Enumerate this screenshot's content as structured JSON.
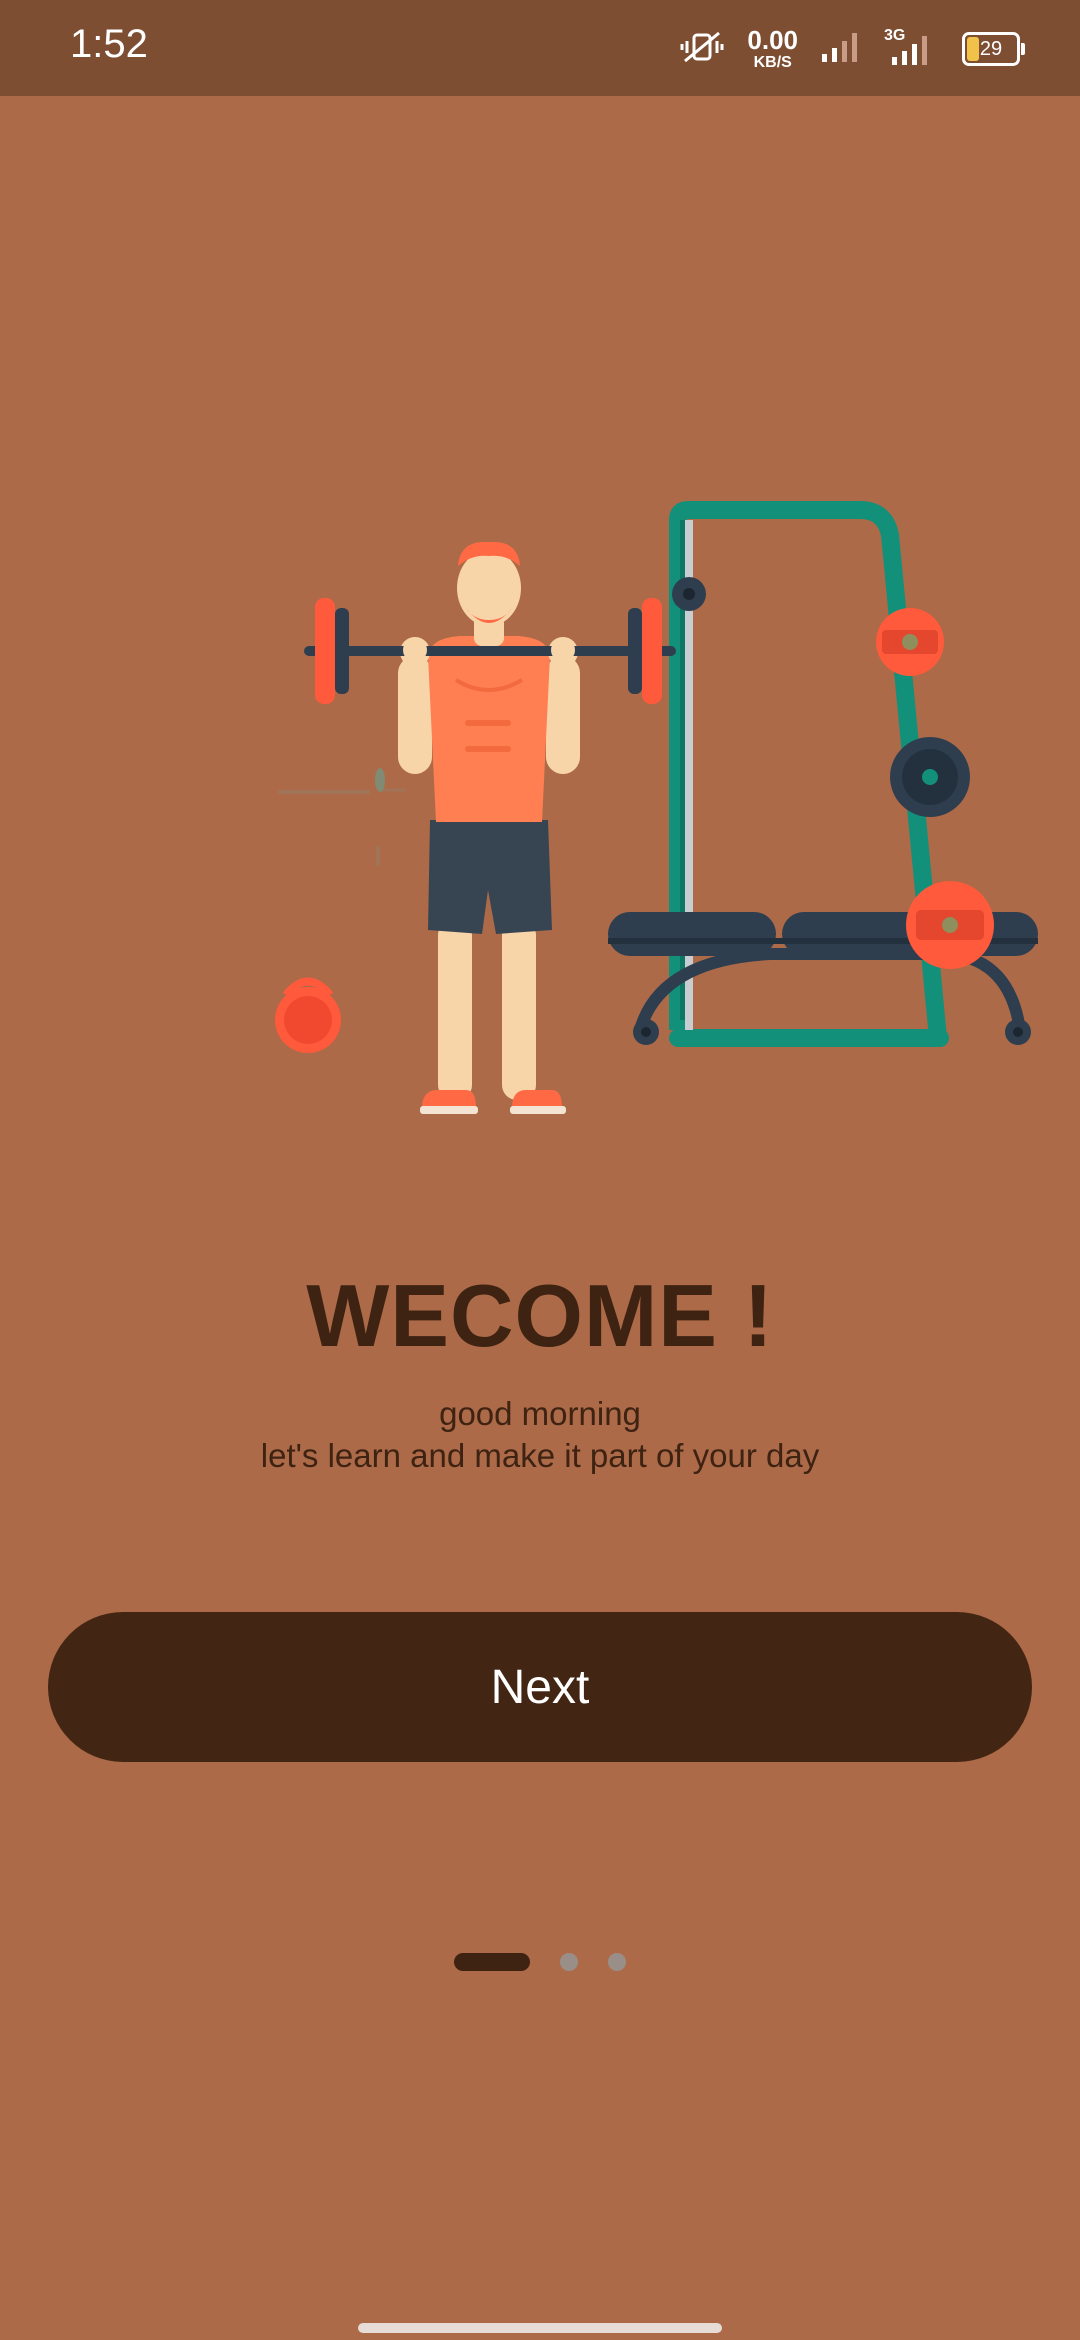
{
  "status_bar": {
    "time": "1:52",
    "net_speed_value": "0.00",
    "net_speed_unit": "KB/S",
    "network_type": "3G",
    "battery_level": "29",
    "icons": [
      "vibrate-off-icon",
      "signal-icon",
      "signal-3g-icon",
      "battery-icon"
    ]
  },
  "onboarding": {
    "illustration": "man-lifting-barbell-gym-illustration",
    "title": "WECOME !",
    "greeting": "good morning",
    "message": "let's learn and make it part of your day",
    "next_label": "Next",
    "page_indicator": {
      "total": 3,
      "current": 1
    }
  },
  "colors": {
    "background": "#AD6A48",
    "status_bar": "#7E4E33",
    "button": "#422613",
    "text_dark": "#3E2212",
    "indicator_inactive": "#9A8F88",
    "accent_orange": "#FF5A3C",
    "rack_teal": "#12907A"
  }
}
